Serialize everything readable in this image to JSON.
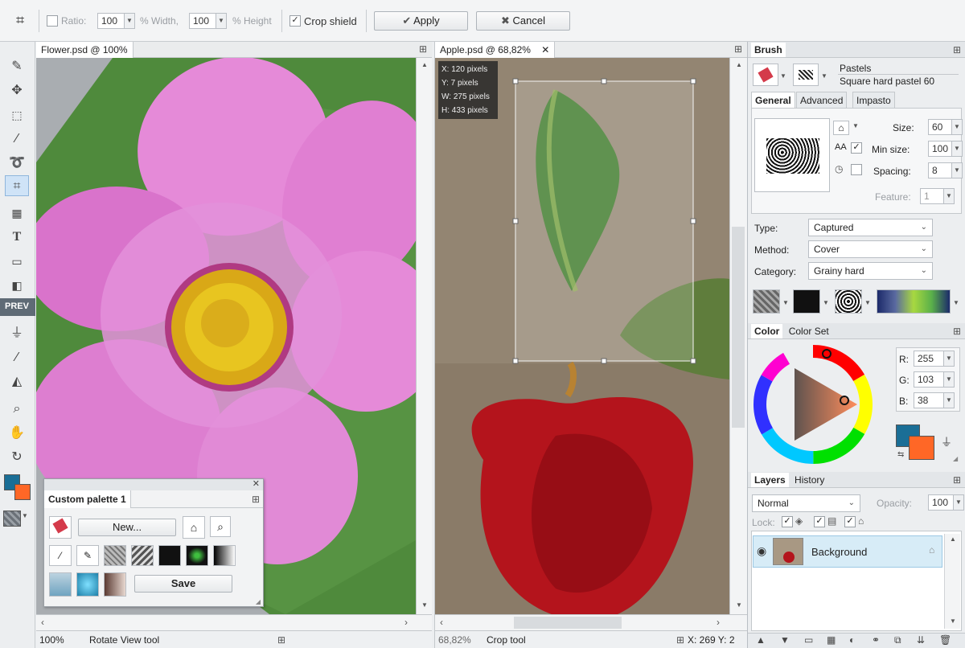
{
  "options_bar": {
    "ratio_label": "Ratio:",
    "ratio_value": "100",
    "width_label": "% Width,",
    "width_value": "100",
    "height_label": "% Height",
    "crop_shield_label": "Crop shield",
    "apply_label": "Apply",
    "cancel_label": "Cancel"
  },
  "toolbar": {
    "prev_label": "PREV",
    "tools": [
      "brush-icon",
      "move-icon",
      "marquee-icon",
      "magic-wand-icon",
      "lasso-icon",
      "crop-icon",
      "perspective-icon",
      "text-icon",
      "shape-icon",
      "gradient-icon",
      "stamp-icon",
      "eyedropper-icon",
      "fill-icon",
      "zoom-icon",
      "hand-icon",
      "rotate-view-icon"
    ]
  },
  "doc_flower": {
    "title": "Flower.psd @ 100%",
    "zoom": "100%",
    "tool_status": "Rotate View tool"
  },
  "doc_apple": {
    "title": "Apple.psd @ 68,82%",
    "zoom": "68,82%",
    "tool_status": "Crop tool",
    "coords": "X: 269  Y: 2",
    "crop_info": {
      "x": "X: 120 pixels",
      "y": "Y: 7 pixels",
      "w": "W: 275 pixels",
      "h": "H: 433 pixels"
    }
  },
  "custom_palette": {
    "title": "Custom palette 1",
    "new_label": "New...",
    "save_label": "Save"
  },
  "brush_panel": {
    "title": "Brush",
    "brush_category": "Pastels",
    "brush_name": "Square hard pastel 60",
    "tabs": [
      "General",
      "Advanced",
      "Impasto"
    ],
    "size_label": "Size:",
    "size_value": "60",
    "min_size_label": "Min size:",
    "min_size_value": "100",
    "spacing_label": "Spacing:",
    "spacing_value": "8",
    "feature_label": "Feature:",
    "feature_value": "1",
    "type_label": "Type:",
    "type_value": "Captured",
    "method_label": "Method:",
    "method_value": "Cover",
    "category_label": "Category:",
    "category_value": "Grainy hard"
  },
  "color_panel": {
    "tabs": [
      "Color",
      "Color Set"
    ],
    "r_label": "R:",
    "r_value": "255",
    "g_label": "G:",
    "g_value": "103",
    "b_label": "B:",
    "b_value": "38",
    "primary_color": "#1a6e96",
    "secondary_color": "#ff6726"
  },
  "layers_panel": {
    "tabs": [
      "Layers",
      "History"
    ],
    "blend_mode": "Normal",
    "opacity_label": "Opacity:",
    "opacity_value": "100",
    "lock_label": "Lock:",
    "layer_name": "Background"
  }
}
